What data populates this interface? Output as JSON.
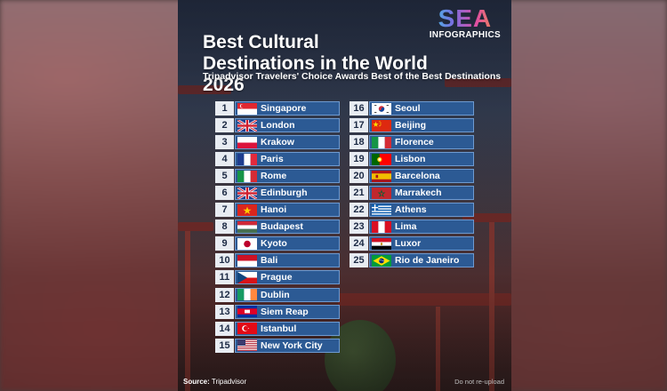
{
  "logo": {
    "line1": "SEA",
    "line2": "INFOGRAPHICS"
  },
  "title": "Best Cultural Destinations in the World 2026",
  "subtitle": "Tripadvisor Travelers' Choice Awards Best of the Best Destinations",
  "left_list": [
    {
      "rank": "1",
      "city": "Singapore",
      "flag": "singapore-flag-icon"
    },
    {
      "rank": "2",
      "city": "London",
      "flag": "uk-flag-icon"
    },
    {
      "rank": "3",
      "city": "Krakow",
      "flag": "poland-flag-icon"
    },
    {
      "rank": "4",
      "city": "Paris",
      "flag": "france-flag-icon"
    },
    {
      "rank": "5",
      "city": "Rome",
      "flag": "italy-flag-icon"
    },
    {
      "rank": "6",
      "city": "Edinburgh",
      "flag": "uk-flag-icon"
    },
    {
      "rank": "7",
      "city": "Hanoi",
      "flag": "vietnam-flag-icon"
    },
    {
      "rank": "8",
      "city": "Budapest",
      "flag": "hungary-flag-icon"
    },
    {
      "rank": "9",
      "city": "Kyoto",
      "flag": "japan-flag-icon"
    },
    {
      "rank": "10",
      "city": "Bali",
      "flag": "indonesia-flag-icon"
    },
    {
      "rank": "11",
      "city": "Prague",
      "flag": "czech-flag-icon"
    },
    {
      "rank": "12",
      "city": "Dublin",
      "flag": "ireland-flag-icon"
    },
    {
      "rank": "13",
      "city": "Siem Reap",
      "flag": "cambodia-flag-icon"
    },
    {
      "rank": "14",
      "city": "Istanbul",
      "flag": "turkey-flag-icon"
    },
    {
      "rank": "15",
      "city": "New York City",
      "flag": "usa-flag-icon"
    }
  ],
  "right_list": [
    {
      "rank": "16",
      "city": "Seoul",
      "flag": "south-korea-flag-icon"
    },
    {
      "rank": "17",
      "city": "Beijing",
      "flag": "china-flag-icon"
    },
    {
      "rank": "18",
      "city": "Florence",
      "flag": "italy-flag-icon"
    },
    {
      "rank": "19",
      "city": "Lisbon",
      "flag": "portugal-flag-icon"
    },
    {
      "rank": "20",
      "city": "Barcelona",
      "flag": "spain-flag-icon"
    },
    {
      "rank": "21",
      "city": "Marrakech",
      "flag": "morocco-flag-icon"
    },
    {
      "rank": "22",
      "city": "Athens",
      "flag": "greece-flag-icon"
    },
    {
      "rank": "23",
      "city": "Lima",
      "flag": "peru-flag-icon"
    },
    {
      "rank": "24",
      "city": "Luxor",
      "flag": "egypt-flag-icon"
    },
    {
      "rank": "25",
      "city": "Rio de Janeiro",
      "flag": "brazil-flag-icon"
    }
  ],
  "footer": {
    "source_label": "Source:",
    "source_value": "Tripadvisor",
    "note": "Do not re-upload"
  },
  "colors": {
    "bar": "#2c5a94",
    "rank_bg": "#e8ecf2",
    "rank_text": "#1c2a44"
  }
}
